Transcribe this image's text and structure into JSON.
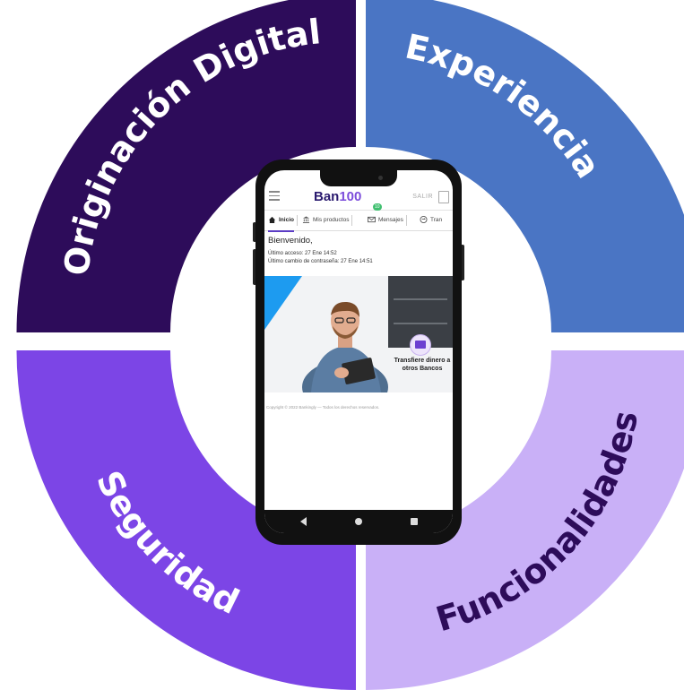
{
  "quadrants": [
    {
      "label": "Originación Digital",
      "color": "#2d0c5a",
      "text_color": "#ffffff"
    },
    {
      "label": "Experiencia",
      "color": "#4a75c4",
      "text_color": "#ffffff"
    },
    {
      "label": "Seguridad",
      "color": "#7c45e6",
      "text_color": "#ffffff"
    },
    {
      "label": "Funcionalidades",
      "color": "#c9b0f7",
      "text_color": "#2d0c5a"
    }
  ],
  "phone": {
    "logo_main": "Ban",
    "logo_accent": "100",
    "exit_label": "SALIR",
    "tabs": [
      {
        "label": "Inicio",
        "icon": "home-icon"
      },
      {
        "label": "Mis productos",
        "icon": "bank-icon"
      },
      {
        "label": "Mensajes",
        "icon": "mail-icon",
        "badge": "10"
      },
      {
        "label": "Tran",
        "icon": "transfer-icon"
      }
    ],
    "welcome": "Bienvenido,",
    "last_access": "Último acceso: 27 Ene 14:52",
    "last_password_change": "Último cambio de contraseña: 27 Ene 14:51",
    "promo_text": "Transfiere dinero a otros Bancos",
    "footer": "Copyright © 2022 Bankingly — Todos los derechos reservados."
  }
}
